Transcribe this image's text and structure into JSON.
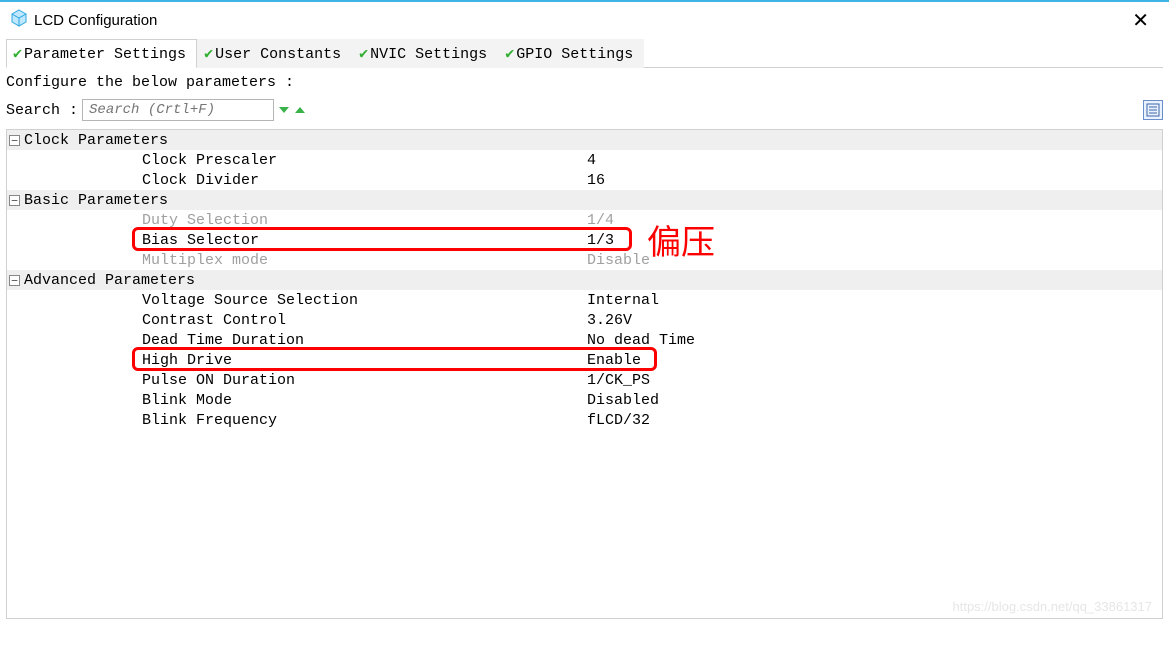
{
  "window": {
    "title": "LCD Configuration"
  },
  "tabs": {
    "t0": "Parameter Settings",
    "t1": "User Constants",
    "t2": "NVIC Settings",
    "t3": "GPIO Settings"
  },
  "instruct": "Configure the below parameters :",
  "search": {
    "label": "Search :",
    "placeholder": "Search (Crtl+F)"
  },
  "groups": {
    "g0": "Clock Parameters",
    "g1": "Basic Parameters",
    "g2": "Advanced Parameters"
  },
  "rows": {
    "clock_prescaler": {
      "label": "Clock Prescaler",
      "value": "4"
    },
    "clock_divider": {
      "label": "Clock Divider",
      "value": "16"
    },
    "duty_selection": {
      "label": "Duty Selection",
      "value": "1/4"
    },
    "bias_selector": {
      "label": "Bias Selector",
      "value": "1/3"
    },
    "multiplex_mode": {
      "label": "Multiplex mode",
      "value": "Disable"
    },
    "vsrc": {
      "label": "Voltage Source Selection",
      "value": "Internal"
    },
    "contrast": {
      "label": "Contrast Control",
      "value": "3.26V"
    },
    "deadtime": {
      "label": "Dead Time Duration",
      "value": "No dead Time"
    },
    "highdrive": {
      "label": "High Drive",
      "value": "Enable"
    },
    "pulse_on": {
      "label": "Pulse ON Duration",
      "value": "1/CK_PS"
    },
    "blink_mode": {
      "label": "Blink Mode",
      "value": "Disabled"
    },
    "blink_freq": {
      "label": "Blink Frequency",
      "value": "fLCD/32"
    }
  },
  "annotation": {
    "text": "偏压"
  },
  "watermark": "https://blog.csdn.net/qq_33861317"
}
